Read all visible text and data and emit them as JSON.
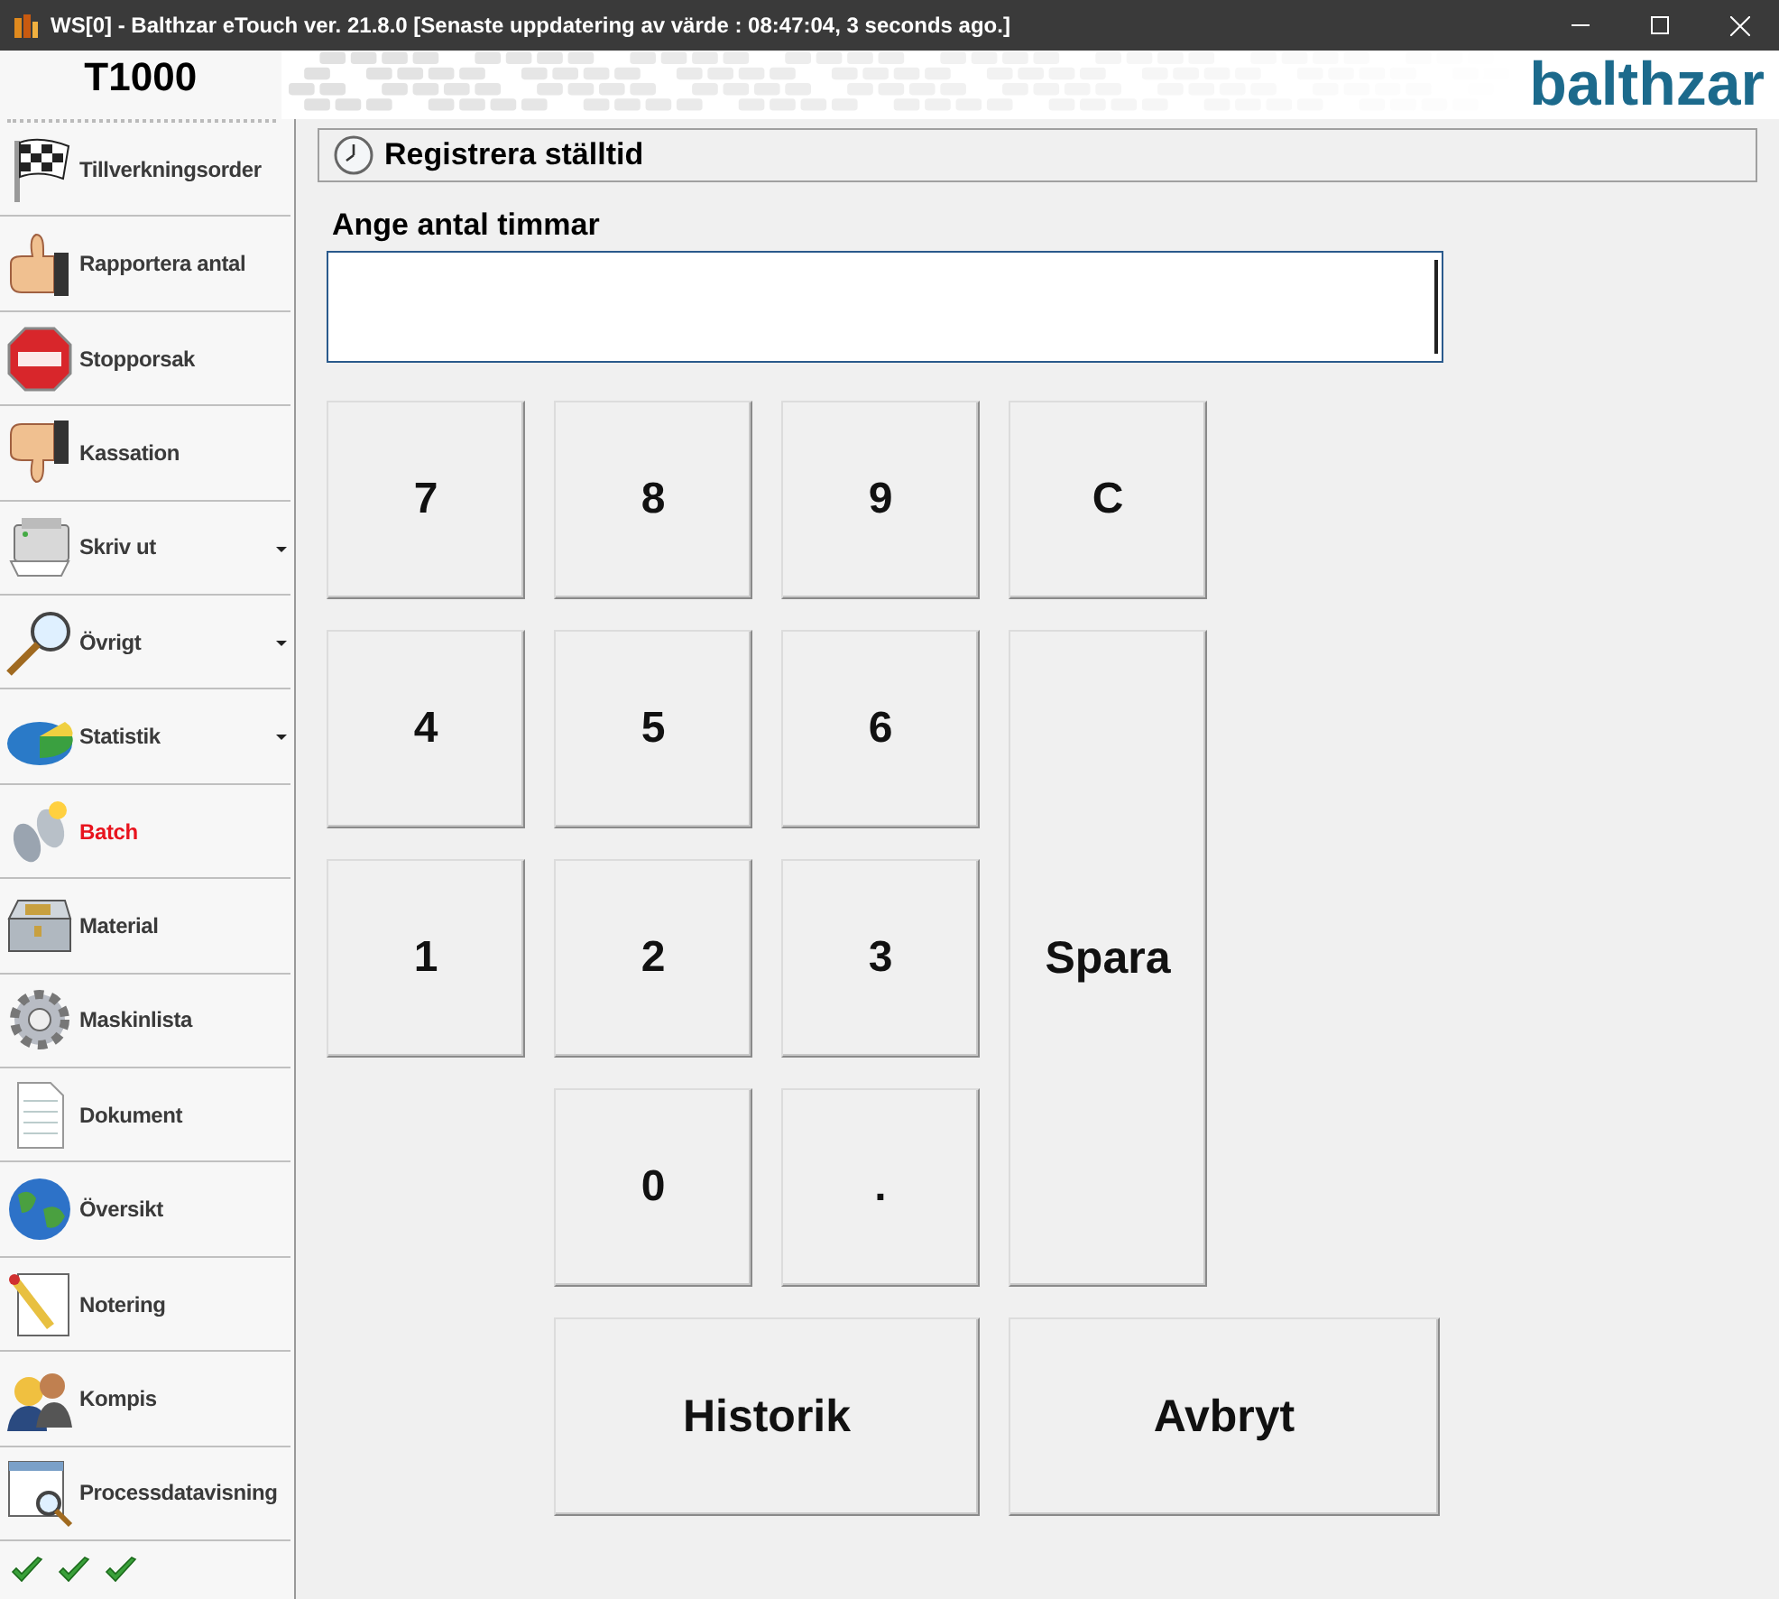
{
  "window": {
    "title": "WS[0] - Balthzar eTouch ver. 21.8.0  [Senaste uppdatering av värde : 08:47:04, 3 seconds ago.]"
  },
  "header": {
    "station": "T1000",
    "logo": "balthzar"
  },
  "sidebar": {
    "items": [
      {
        "label": "Tillverkningsorder",
        "selected": false,
        "has_menu": false
      },
      {
        "label": "Rapportera antal",
        "selected": false,
        "has_menu": false
      },
      {
        "label": "Stopporsak",
        "selected": false,
        "has_menu": false
      },
      {
        "label": "Kassation",
        "selected": false,
        "has_menu": false
      },
      {
        "label": "Skriv ut",
        "selected": false,
        "has_menu": true
      },
      {
        "label": "Övrigt",
        "selected": false,
        "has_menu": true
      },
      {
        "label": "Statistik",
        "selected": false,
        "has_menu": true
      },
      {
        "label": "Batch",
        "selected": true,
        "has_menu": false
      },
      {
        "label": "Material",
        "selected": false,
        "has_menu": false
      },
      {
        "label": "Maskinlista",
        "selected": false,
        "has_menu": false
      },
      {
        "label": "Dokument",
        "selected": false,
        "has_menu": false
      },
      {
        "label": "Översikt",
        "selected": false,
        "has_menu": false
      },
      {
        "label": "Notering",
        "selected": false,
        "has_menu": false
      },
      {
        "label": "Kompis",
        "selected": false,
        "has_menu": false
      },
      {
        "label": "Processdatavisning",
        "selected": false,
        "has_menu": false
      }
    ]
  },
  "panel": {
    "title": "Registrera ställtid",
    "field_label": "Ange antal timmar",
    "keys": [
      {
        "label": "7",
        "kind": "digit"
      },
      {
        "label": "8",
        "kind": "digit"
      },
      {
        "label": "9",
        "kind": "digit"
      },
      {
        "label": "C",
        "kind": "clear"
      },
      {
        "label": "4",
        "kind": "digit"
      },
      {
        "label": "5",
        "kind": "digit"
      },
      {
        "label": "6",
        "kind": "digit"
      },
      {
        "label": "1",
        "kind": "digit"
      },
      {
        "label": "2",
        "kind": "digit"
      },
      {
        "label": "3",
        "kind": "digit"
      },
      {
        "label": "Spara",
        "kind": "save"
      },
      {
        "label": "0",
        "kind": "digit"
      },
      {
        "label": ".",
        "kind": "digit"
      },
      {
        "label": "Historik",
        "kind": "history"
      },
      {
        "label": "Avbryt",
        "kind": "cancel"
      }
    ]
  }
}
